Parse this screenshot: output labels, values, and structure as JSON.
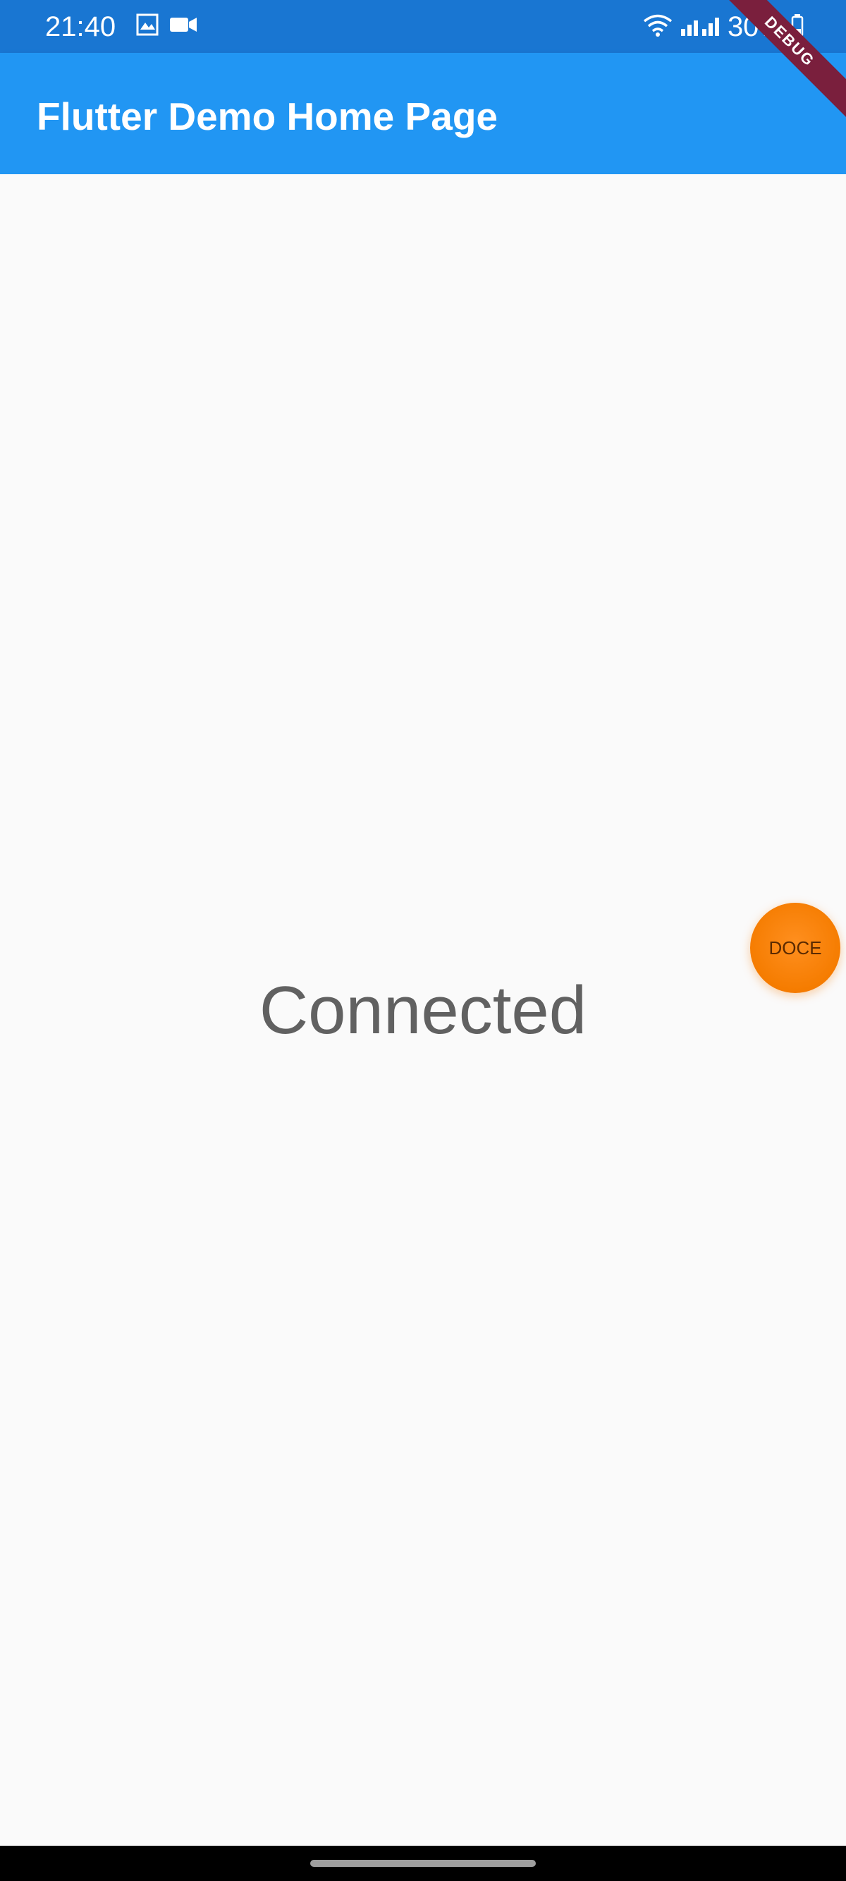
{
  "status_bar": {
    "time": "21:40",
    "battery_text": "30%",
    "icons": [
      "gallery-icon",
      "video-camera-icon",
      "wifi-icon",
      "signal-icon",
      "battery-icon"
    ]
  },
  "app_bar": {
    "title": "Flutter Demo Home Page",
    "debug_banner": "DEBUG"
  },
  "main": {
    "status_message": "Connected"
  },
  "floating_bubble": {
    "label": "DOCE"
  },
  "colors": {
    "status_bar": "#1976d2",
    "app_bar": "#2196f3",
    "background": "#fafafa",
    "bubble": "#f57c00",
    "debug_banner": "#7a1f3d"
  }
}
